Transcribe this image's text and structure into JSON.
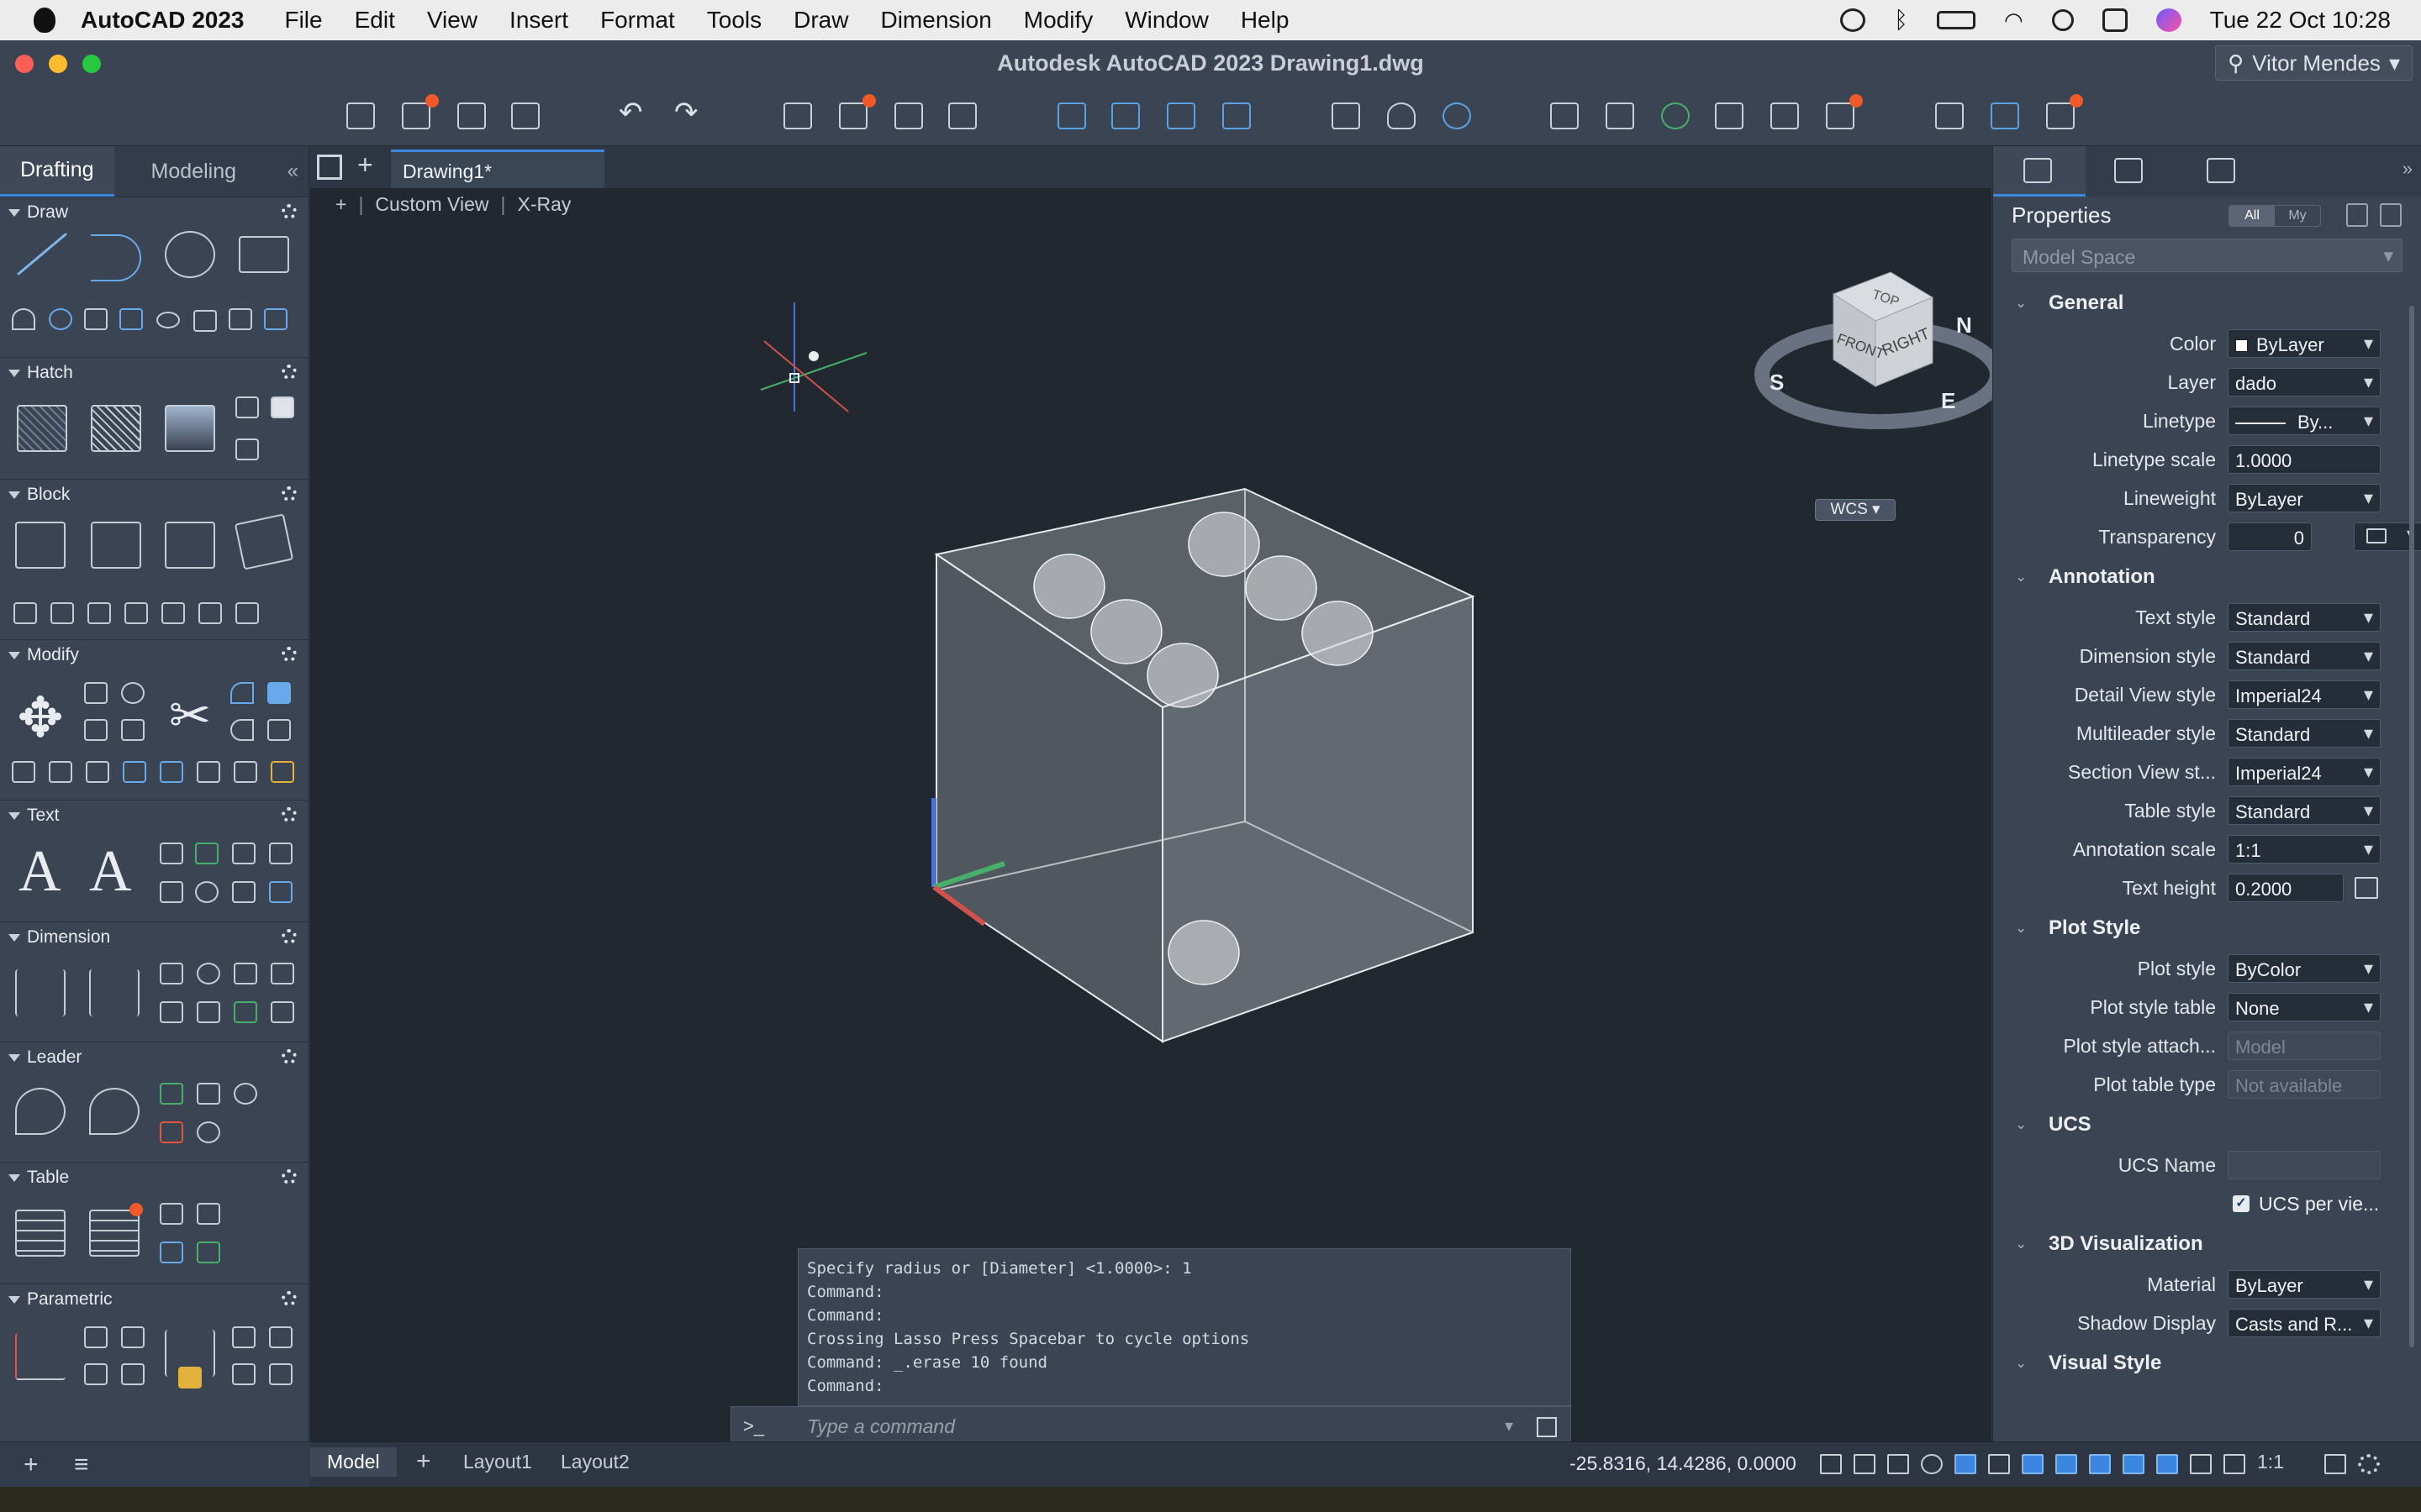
{
  "menubar": {
    "app": "AutoCAD 2023",
    "items": [
      "File",
      "Edit",
      "View",
      "Insert",
      "Format",
      "Tools",
      "Draw",
      "Dimension",
      "Modify",
      "Window",
      "Help"
    ],
    "clock": "Tue 22 Oct  10:28"
  },
  "window": {
    "title": "Autodesk AutoCAD 2023    Drawing1.dwg",
    "user": "Vitor Mendes"
  },
  "left_panel": {
    "tabs": [
      "Drafting",
      "Modeling"
    ],
    "collapse_label": "«",
    "sections": [
      "Draw",
      "Hatch",
      "Block",
      "Modify",
      "Text",
      "Dimension",
      "Leader",
      "Table",
      "Parametric"
    ],
    "text_tool_glyph": "A"
  },
  "document": {
    "tab": "Drawing1*",
    "view_plus": "+",
    "view": "Custom View",
    "style": "X-Ray"
  },
  "viewcube": {
    "top": "TOP",
    "front": "FRONT",
    "right": "RIGHT",
    "compass_n": "N",
    "compass_s": "S",
    "compass_e": "E",
    "wcs": "WCS"
  },
  "command": {
    "history": [
      "Specify radius or [Diameter] <1.0000>: 1",
      "Command:",
      "Command:",
      "Crossing Lasso  Press Spacebar to cycle options",
      "Command: _.erase 10 found",
      "Command:"
    ],
    "prompt": ">_",
    "placeholder": "Type a command"
  },
  "properties": {
    "title": "Properties",
    "filter": [
      "All",
      "My"
    ],
    "space": "Model Space",
    "groups": {
      "general": "General",
      "annotation": "Annotation",
      "plot": "Plot Style",
      "ucs": "UCS",
      "viz": "3D Visualization",
      "visual": "Visual Style"
    },
    "general": [
      {
        "label": "Color",
        "value": "ByLayer"
      },
      {
        "label": "Layer",
        "value": "dado"
      },
      {
        "label": "Linetype",
        "value": "By..."
      },
      {
        "label": "Linetype scale",
        "value": "1.0000"
      },
      {
        "label": "Lineweight",
        "value": "ByLayer"
      },
      {
        "label": "Transparency",
        "value": "0"
      }
    ],
    "annotation": [
      {
        "label": "Text style",
        "value": "Standard"
      },
      {
        "label": "Dimension style",
        "value": "Standard"
      },
      {
        "label": "Detail View style",
        "value": "Imperial24"
      },
      {
        "label": "Multileader style",
        "value": "Standard"
      },
      {
        "label": "Section View st...",
        "value": "Imperial24"
      },
      {
        "label": "Table style",
        "value": "Standard"
      },
      {
        "label": "Annotation scale",
        "value": "1:1"
      },
      {
        "label": "Text height",
        "value": "0.2000"
      }
    ],
    "plot": [
      {
        "label": "Plot style",
        "value": "ByColor"
      },
      {
        "label": "Plot style table",
        "value": "None"
      },
      {
        "label": "Plot style attach...",
        "value": "Model"
      },
      {
        "label": "Plot table type",
        "value": "Not available"
      }
    ],
    "ucs": [
      {
        "label": "UCS Name",
        "value": ""
      },
      {
        "label": "UCS per vie...",
        "checked": true
      }
    ],
    "viz": [
      {
        "label": "Material",
        "value": "ByLayer"
      },
      {
        "label": "Shadow Display",
        "value": "Casts and R..."
      }
    ]
  },
  "status": {
    "tabs": [
      "Model",
      "Layout1",
      "Layout2"
    ],
    "add": "+",
    "coords": "-25.8316, 14.4286, 0.0000",
    "scale": "1:1"
  },
  "colors": {
    "accent": "#3b86e0",
    "badge": "#f05a28",
    "canvas": "#212830",
    "panel": "#3b4453"
  }
}
